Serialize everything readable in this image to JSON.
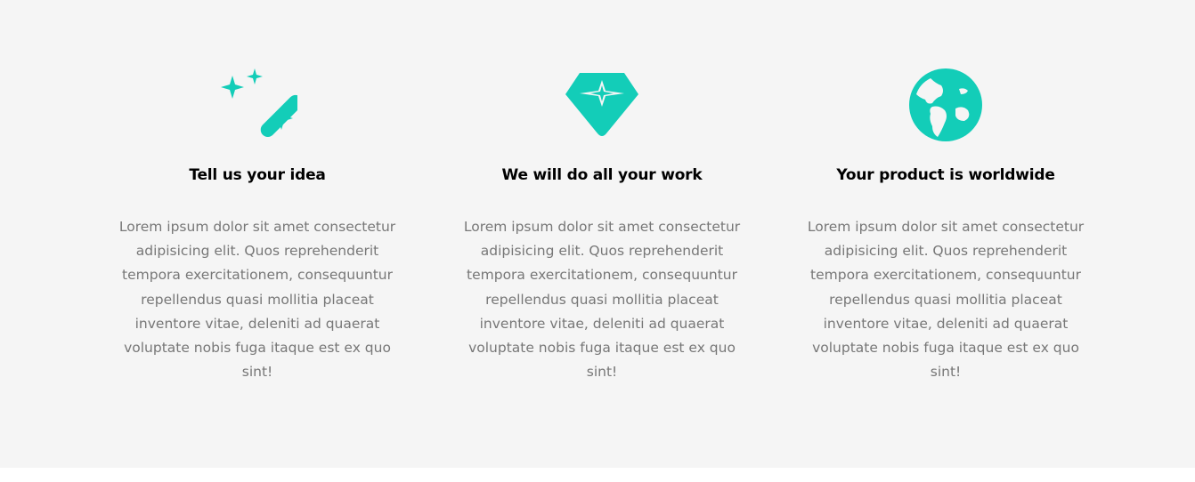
{
  "theme": {
    "background": "#f5f5f5",
    "accent": "#13cdb8",
    "title_color": "#000000",
    "text_color": "#777777"
  },
  "features": [
    {
      "icon": "magic-wand-icon",
      "title": "Tell us your idea",
      "description": "Lorem ipsum dolor sit amet consectetur adipisicing elit. Quos reprehenderit tempora exercitationem, consequuntur repellendus quasi mollitia placeat inventore vitae, deleniti ad quaerat voluptate nobis fuga itaque est ex quo sint!"
    },
    {
      "icon": "gem-icon",
      "title": "We will do all your work",
      "description": "Lorem ipsum dolor sit amet consectetur adipisicing elit. Quos reprehenderit tempora exercitationem, consequuntur repellendus quasi mollitia placeat inventore vitae, deleniti ad quaerat voluptate nobis fuga itaque est ex quo sint!"
    },
    {
      "icon": "globe-icon",
      "title": "Your product is worldwide",
      "description": "Lorem ipsum dolor sit amet consectetur adipisicing elit. Quos reprehenderit tempora exercitationem, consequuntur repellendus quasi mollitia placeat inventore vitae, deleniti ad quaerat voluptate nobis fuga itaque est ex quo sint!"
    }
  ]
}
